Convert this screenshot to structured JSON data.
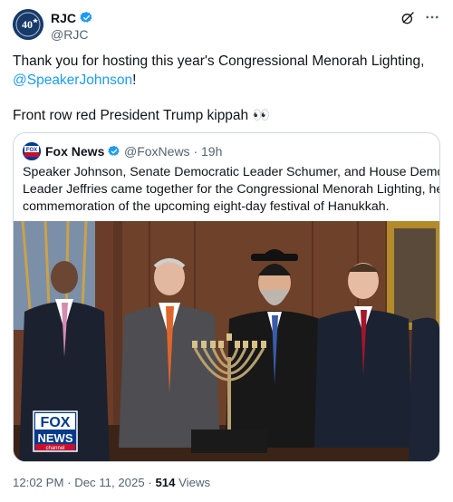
{
  "author": {
    "name": "RJC",
    "handle": "@RJC",
    "avatar_text": "40",
    "avatar_icon": "rjc-anniversary-logo"
  },
  "tweet": {
    "line1": "Thank you for hosting this year's Congressional Menorah Lighting,",
    "mention": "@SpeakerJohnson",
    "mention_suffix": "!",
    "line3": "Front row red President Trump kippah",
    "emoji": "👀"
  },
  "quote": {
    "name": "Fox News",
    "handle": "@FoxNews",
    "separator": "·",
    "time": "19h",
    "lines": [
      "Speaker Johnson, Senate Democratic Leader Schumer, and House Democratic",
      "Leader Jeffries came together for the Congressional Menorah Lighting, held in",
      "commemoration of the upcoming eight-day festival of Hanukkah."
    ],
    "media_logo_top": "FOX",
    "media_logo_bottom": "NEWS",
    "media_logo_sub": "channel"
  },
  "meta": {
    "time": "12:02 PM",
    "separator": "·",
    "date": "Dec 11, 2025",
    "separator2": "·",
    "views_count": "514",
    "views_label": "Views"
  },
  "colors": {
    "verified": "#1d9bf0",
    "mention": "#1d9bf0",
    "secondary_text": "#536471",
    "border": "#cfd9de",
    "fox_red": "#c8102e",
    "fox_blue": "#003a8c"
  },
  "icons": [
    "verified-badge-icon",
    "grok-icon",
    "more-options-icon",
    "fox-news-logo"
  ]
}
